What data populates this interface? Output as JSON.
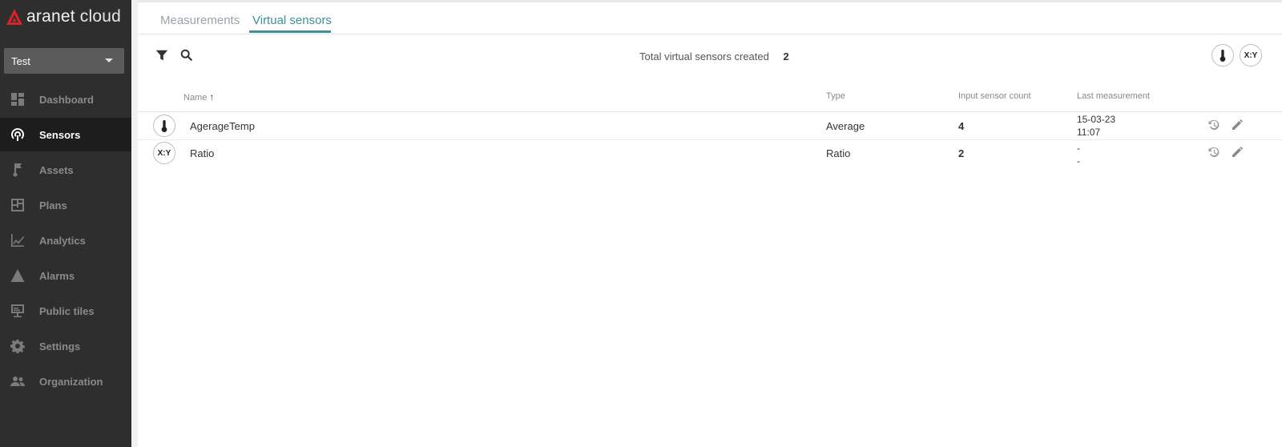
{
  "brand": {
    "name_part1": "aranet",
    "name_part2": "cloud",
    "accent": "#d8232a"
  },
  "org_select": {
    "value": "Test"
  },
  "nav": [
    {
      "label": "Dashboard",
      "icon": "dashboard-icon",
      "active": false
    },
    {
      "label": "Sensors",
      "icon": "sensors-icon",
      "active": true
    },
    {
      "label": "Assets",
      "icon": "assets-icon",
      "active": false
    },
    {
      "label": "Plans",
      "icon": "plans-icon",
      "active": false
    },
    {
      "label": "Analytics",
      "icon": "analytics-icon",
      "active": false
    },
    {
      "label": "Alarms",
      "icon": "alarms-icon",
      "active": false
    },
    {
      "label": "Public tiles",
      "icon": "public-tiles-icon",
      "active": false
    },
    {
      "label": "Settings",
      "icon": "settings-icon",
      "active": false
    },
    {
      "label": "Organization",
      "icon": "organization-icon",
      "active": false
    }
  ],
  "tabs": [
    {
      "label": "Measurements",
      "active": false
    },
    {
      "label": "Virtual sensors",
      "active": true
    }
  ],
  "toolbar": {
    "total_label": "Total virtual sensors created",
    "total_value": "2",
    "ratio_badge": "X:Y"
  },
  "table": {
    "columns": {
      "name": "Name",
      "type": "Type",
      "count": "Input sensor count",
      "last": "Last measurement"
    },
    "sort_indicator": "↑",
    "rows": [
      {
        "icon": "thermometer-icon",
        "badge": "",
        "name": "AgerageTemp",
        "type": "Average",
        "count": "4",
        "last_date": "15-03-23",
        "last_time": "11:07"
      },
      {
        "icon": "ratio-icon",
        "badge": "X:Y",
        "name": "Ratio",
        "type": "Ratio",
        "count": "2",
        "last_date": "-",
        "last_time": "-"
      }
    ]
  },
  "colors": {
    "sidebar": "#2e2e2e",
    "sidebar_active": "#1d1d1d",
    "tab_active": "#3f8f95"
  }
}
